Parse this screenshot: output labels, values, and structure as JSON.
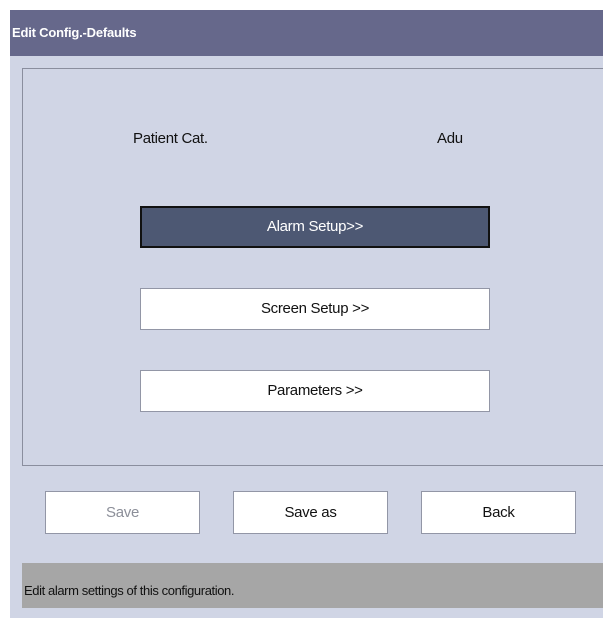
{
  "window": {
    "title": "Edit Config.-Defaults"
  },
  "patient_category": {
    "label": "Patient Cat.",
    "value": "Adu"
  },
  "menu": {
    "alarm_setup": "Alarm Setup>>",
    "screen_setup": "Screen Setup >>",
    "parameters": "Parameters >>"
  },
  "footer": {
    "save": "Save",
    "save_as": "Save as",
    "back": "Back"
  },
  "status": {
    "text": "Edit alarm settings of this configuration."
  },
  "colors": {
    "title_bar": "#66688b",
    "dialog_bg": "#d0d5e5",
    "selected_button": "#4d5873",
    "status_bar": "#a6a6a6"
  }
}
